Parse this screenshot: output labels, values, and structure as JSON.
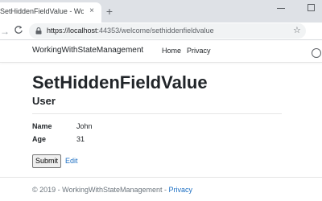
{
  "browser": {
    "tab_title": "SetHiddenFieldValue - WorkingW",
    "tab_close": "×",
    "new_tab": "+",
    "forward_glyph": "→",
    "reload_glyph": "C",
    "url_host": "https://localhost",
    "url_rest": ":44353/welcome/sethiddenfieldvalue",
    "star_glyph": "☆"
  },
  "navbar": {
    "brand": "WorkingWithStateManagement",
    "links": [
      "Home",
      "Privacy"
    ]
  },
  "main": {
    "title": "SetHiddenFieldValue",
    "subtitle": "User",
    "fields": [
      {
        "label": "Name",
        "value": "John"
      },
      {
        "label": "Age",
        "value": "31"
      }
    ],
    "submit_label": "Submit",
    "edit_label": "Edit"
  },
  "footer": {
    "text": "© 2019 - WorkingWithStateManagement - ",
    "link": "Privacy"
  },
  "colors": {
    "link": "#1b6ec2",
    "text": "#212529",
    "muted": "#6c757d",
    "tabstrip": "#dee1e6"
  }
}
